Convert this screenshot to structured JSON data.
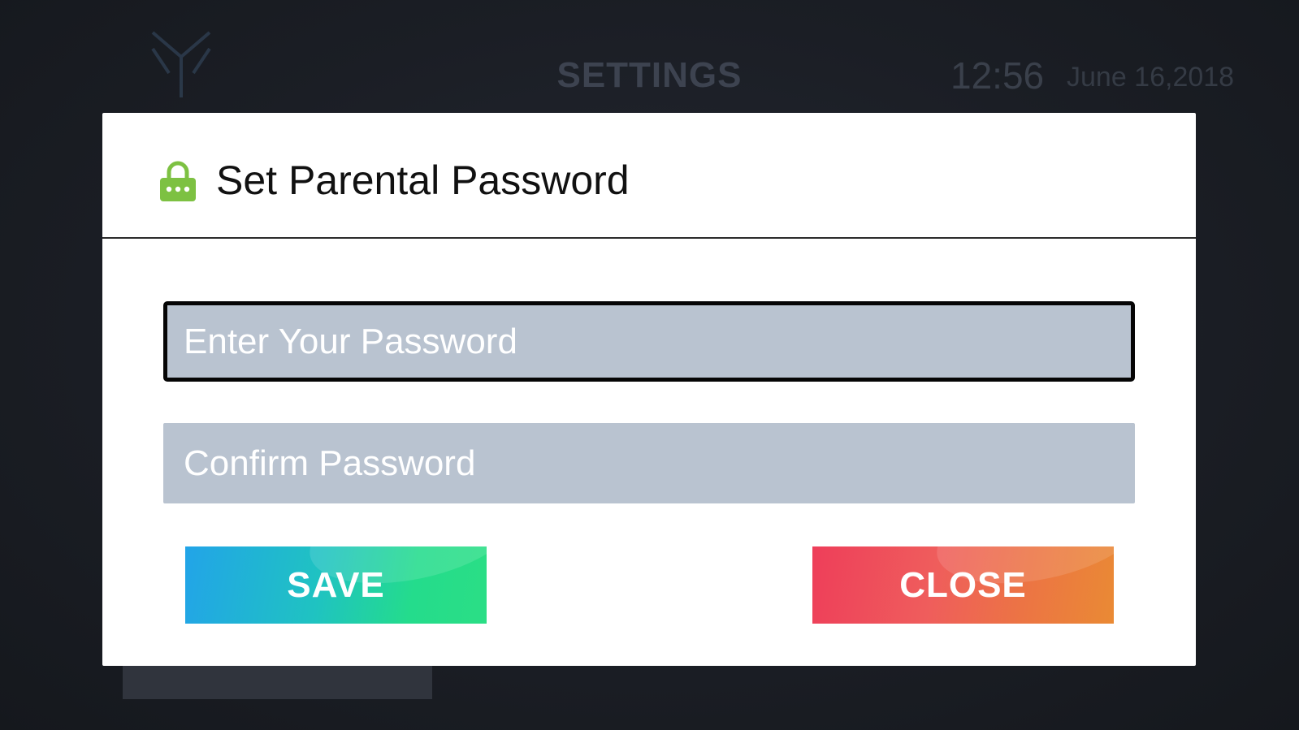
{
  "background": {
    "title": "SETTINGS",
    "time": "12:56",
    "date": "June 16,2018"
  },
  "dialog": {
    "icon": "lock-icon",
    "title": "Set Parental Password",
    "password_placeholder": "Enter Your Password",
    "confirm_placeholder": "Confirm Password",
    "save_label": "SAVE",
    "close_label": "CLOSE"
  },
  "colors": {
    "lock_green": "#7dc142",
    "field_bg": "#b9c3d0",
    "save_gradient": [
      "#22a4e8",
      "#2bde85"
    ],
    "close_gradient": [
      "#ee3e5a",
      "#ea8a34"
    ]
  }
}
